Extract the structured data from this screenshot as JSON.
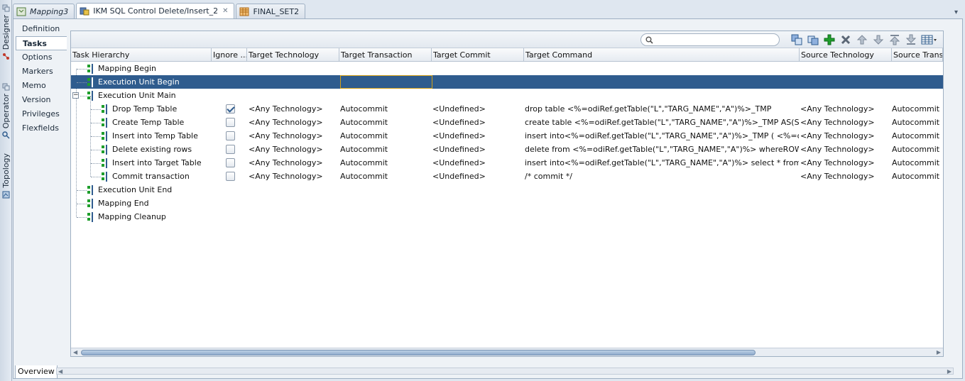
{
  "rail": {
    "designer": "Designer",
    "operator": "Operator",
    "topology": "Topology"
  },
  "tabs": [
    {
      "label": "Mapping3"
    },
    {
      "label": "IKM SQL Control Delete/Insert_2"
    },
    {
      "label": "FINAL_SET2"
    }
  ],
  "sidenav": [
    "Definition",
    "Tasks",
    "Options",
    "Markers",
    "Memo",
    "Version",
    "Privileges",
    "Flexfields"
  ],
  "search": {
    "value": ""
  },
  "columns": [
    "Task Hierarchy",
    "Ignore ...",
    "Target Technology",
    "Target Transaction",
    "Target Commit",
    "Target Command",
    "Source Technology",
    "Source Trans"
  ],
  "tree": [
    {
      "name": "Mapping Begin"
    },
    {
      "name": "Execution Unit Begin"
    },
    {
      "name": "Execution Unit Main"
    },
    {
      "name": "Drop Temp Table",
      "ignore": true,
      "tech": "<Any Technology>",
      "trans": "Autocommit",
      "commit": "<Undefined>",
      "command": "drop table  <%=odiRef.getTable(\"L\",\"TARG_NAME\",\"A\")%>_TMP",
      "src_tech": "<Any Technology>",
      "src_trans": "Autocommit"
    },
    {
      "name": "Create Temp Table",
      "ignore": false,
      "tech": "<Any Technology>",
      "trans": "Autocommit",
      "commit": "<Undefined>",
      "command": "create table  <%=odiRef.getTable(\"L\",\"TARG_NAME\",\"A\")%>_TMP AS(SE...",
      "src_tech": "<Any Technology>",
      "src_trans": "Autocommit"
    },
    {
      "name": "Insert into Temp Table",
      "ignore": false,
      "tech": "<Any Technology>",
      "trans": "Autocommit",
      "commit": "<Undefined>",
      "command": "insert into<%=odiRef.getTable(\"L\",\"TARG_NAME\",\"A\")%>_TMP (  <%=o...",
      "src_tech": "<Any Technology>",
      "src_trans": "Autocommit"
    },
    {
      "name": "Delete existing rows",
      "ignore": false,
      "tech": "<Any Technology>",
      "trans": "Autocommit",
      "commit": "<Undefined>",
      "command": "delete   from   <%=odiRef.getTable(\"L\",\"TARG_NAME\",\"A\")%> whereROW...",
      "src_tech": "<Any Technology>",
      "src_trans": "Autocommit"
    },
    {
      "name": "Insert into Target Table",
      "ignore": false,
      "tech": "<Any Technology>",
      "trans": "Autocommit",
      "commit": "<Undefined>",
      "command": "insert into<%=odiRef.getTable(\"L\",\"TARG_NAME\",\"A\")%> select  * from ...",
      "src_tech": "<Any Technology>",
      "src_trans": "Autocommit"
    },
    {
      "name": "Commit transaction",
      "ignore": false,
      "tech": "<Any Technology>",
      "trans": "Autocommit",
      "commit": "<Undefined>",
      "command": "/* commit */",
      "src_tech": "<Any Technology>",
      "src_trans": "Autocommit"
    },
    {
      "name": "Execution Unit End"
    },
    {
      "name": "Mapping End"
    },
    {
      "name": "Mapping Cleanup"
    }
  ],
  "bottom_tab": "Overview",
  "colors": {
    "selection": "#2f5c8e",
    "edit_border": "#d4a017",
    "add_green": "#1f9e2c"
  },
  "toolbar_icons": [
    "copy-icon",
    "paste-icon",
    "add-icon",
    "delete-icon",
    "move-up-icon",
    "move-down-icon",
    "move-top-icon",
    "move-bottom-icon",
    "columns-icon"
  ]
}
